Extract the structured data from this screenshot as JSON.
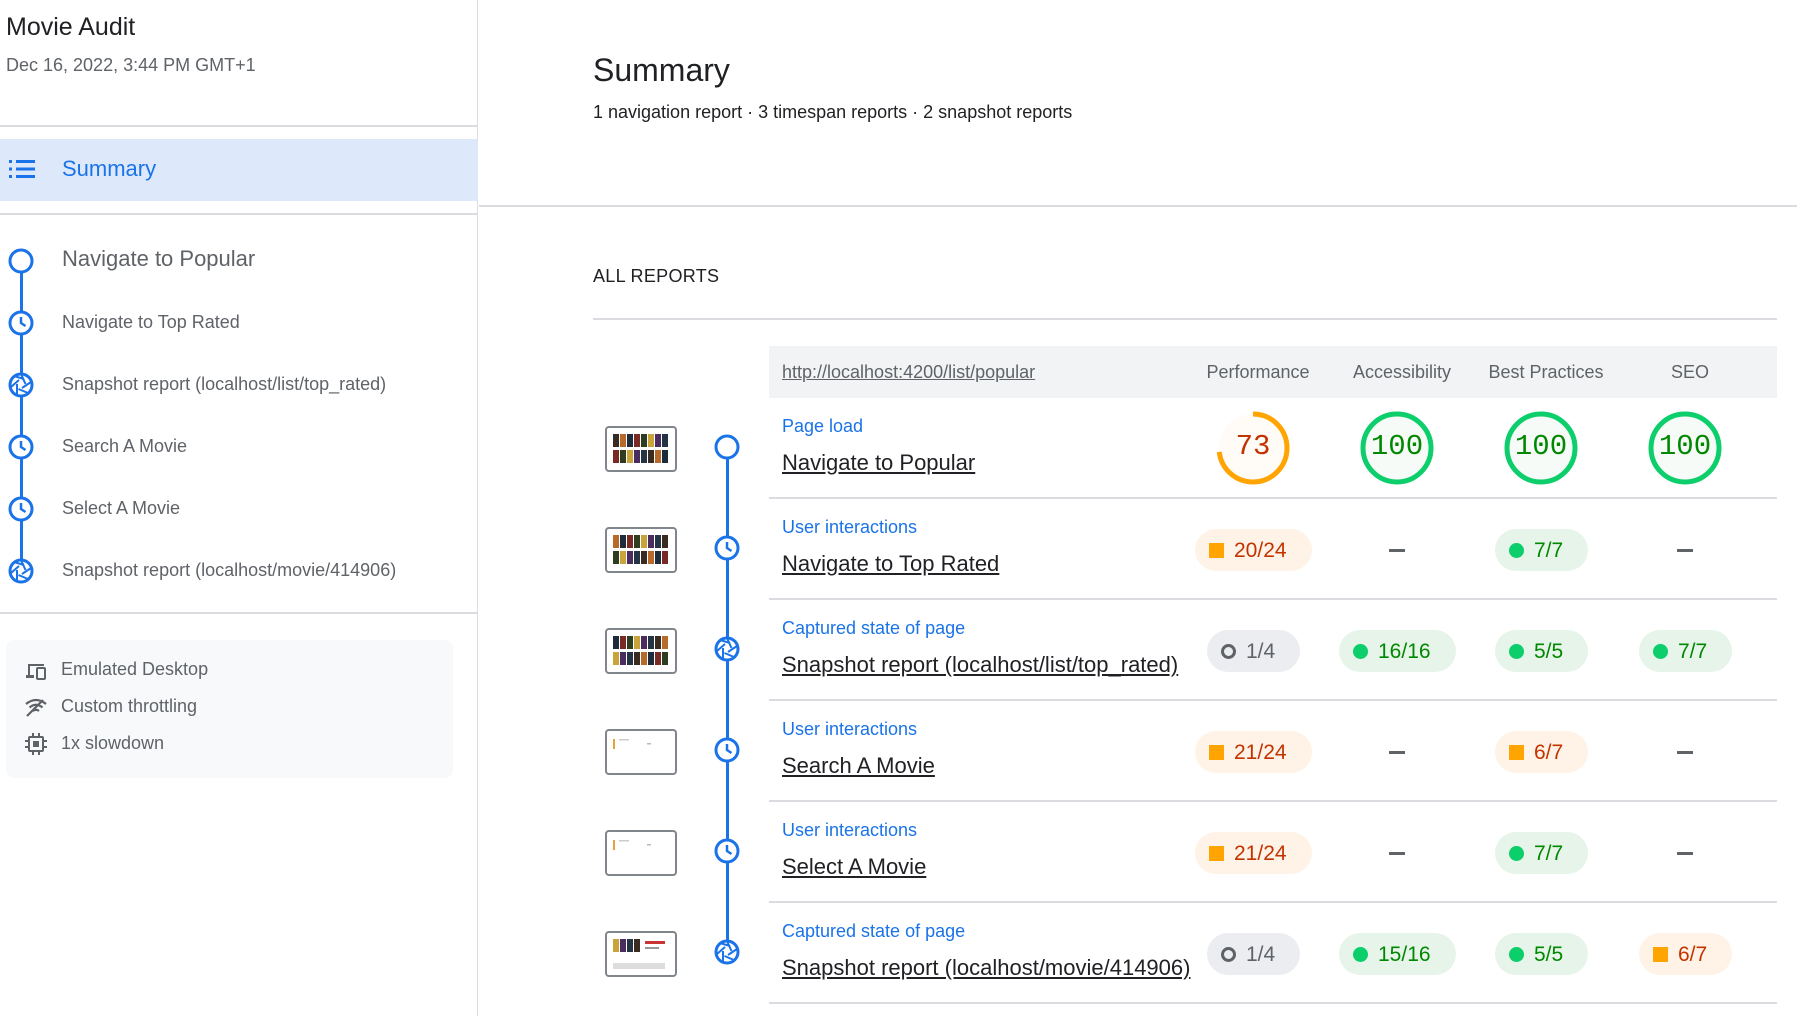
{
  "sidebar": {
    "title": "Movie Audit",
    "date": "Dec 16, 2022, 3:44 PM GMT+1",
    "summary_label": "Summary",
    "steps": [
      {
        "label": "Navigate to Popular",
        "icon": "navigation-icon"
      },
      {
        "label": "Navigate to Top Rated",
        "icon": "timespan-icon"
      },
      {
        "label": "Snapshot report (localhost/list/top_rated)",
        "icon": "snapshot-icon"
      },
      {
        "label": "Search A Movie",
        "icon": "timespan-icon"
      },
      {
        "label": "Select A Movie",
        "icon": "timespan-icon"
      },
      {
        "label": "Snapshot report (localhost/movie/414906)",
        "icon": "snapshot-icon"
      }
    ],
    "environment": [
      {
        "label": "Emulated Desktop",
        "icon": "devices-icon"
      },
      {
        "label": "Custom throttling",
        "icon": "network-icon"
      },
      {
        "label": "1x slowdown",
        "icon": "cpu-icon"
      }
    ]
  },
  "main": {
    "title": "Summary",
    "subtitle": "1 navigation report · 3 timespan reports · 2 snapshot reports",
    "section_title": "ALL REPORTS",
    "url": "http://localhost:4200/list/popular",
    "columns": [
      "Performance",
      "Accessibility",
      "Best Practices",
      "SEO"
    ],
    "rows": [
      {
        "type": "Page load",
        "name": "Navigate to Popular",
        "icon": "navigation-icon",
        "scores": [
          {
            "kind": "gauge",
            "value": "73",
            "status": "average"
          },
          {
            "kind": "gauge",
            "value": "100",
            "status": "pass"
          },
          {
            "kind": "gauge",
            "value": "100",
            "status": "pass"
          },
          {
            "kind": "gauge",
            "value": "100",
            "status": "pass"
          }
        ]
      },
      {
        "type": "User interactions",
        "name": "Navigate to Top Rated",
        "icon": "timespan-icon",
        "scores": [
          {
            "kind": "fraction",
            "value": "20/24",
            "status": "average"
          },
          {
            "kind": "none"
          },
          {
            "kind": "fraction",
            "value": "7/7",
            "status": "pass"
          },
          {
            "kind": "none"
          }
        ]
      },
      {
        "type": "Captured state of page",
        "name": "Snapshot report (localhost/list/top_rated)",
        "icon": "snapshot-icon",
        "scores": [
          {
            "kind": "fraction",
            "value": "1/4",
            "status": "informative"
          },
          {
            "kind": "fraction",
            "value": "16/16",
            "status": "pass"
          },
          {
            "kind": "fraction",
            "value": "5/5",
            "status": "pass"
          },
          {
            "kind": "fraction",
            "value": "7/7",
            "status": "pass"
          }
        ]
      },
      {
        "type": "User interactions",
        "name": "Search A Movie",
        "icon": "timespan-icon",
        "scores": [
          {
            "kind": "fraction",
            "value": "21/24",
            "status": "average"
          },
          {
            "kind": "none"
          },
          {
            "kind": "fraction",
            "value": "6/7",
            "status": "average"
          },
          {
            "kind": "none"
          }
        ]
      },
      {
        "type": "User interactions",
        "name": "Select A Movie",
        "icon": "timespan-icon",
        "scores": [
          {
            "kind": "fraction",
            "value": "21/24",
            "status": "average"
          },
          {
            "kind": "none"
          },
          {
            "kind": "fraction",
            "value": "7/7",
            "status": "pass"
          },
          {
            "kind": "none"
          }
        ]
      },
      {
        "type": "Captured state of page",
        "name": "Snapshot report (localhost/movie/414906)",
        "icon": "snapshot-icon",
        "scores": [
          {
            "kind": "fraction",
            "value": "1/4",
            "status": "informative"
          },
          {
            "kind": "fraction",
            "value": "15/16",
            "status": "pass"
          },
          {
            "kind": "fraction",
            "value": "5/5",
            "status": "pass"
          },
          {
            "kind": "fraction",
            "value": "6/7",
            "status": "average"
          }
        ]
      }
    ]
  },
  "colors": {
    "accent": "#1a73e8",
    "pass": "#0cce6b",
    "pass_text": "#008800",
    "average": "#ffa400",
    "average_text": "#c33300",
    "informative": "#5f6368",
    "selected_bg": "#dde9fb"
  }
}
